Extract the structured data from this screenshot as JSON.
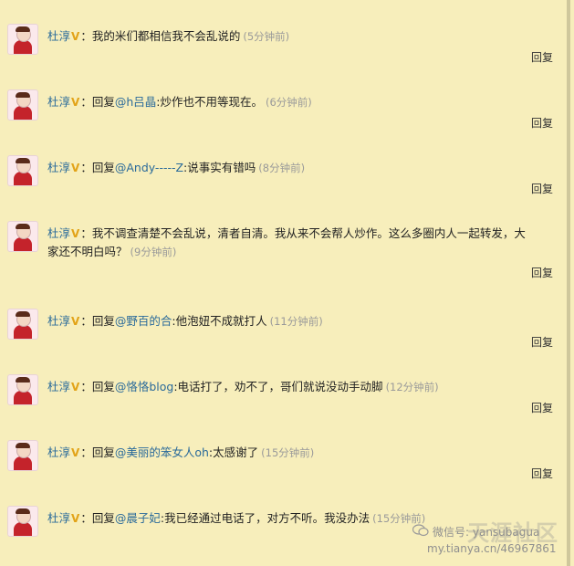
{
  "comments": [
    {
      "user": "杜淳",
      "badge": "V",
      "sep": "：",
      "prefix": "",
      "mention": "",
      "text": "我的米们都相信我不会乱说的",
      "time": "(5分钟前)",
      "reply": "回复"
    },
    {
      "user": "杜淳",
      "badge": "V",
      "sep": "：",
      "prefix": "回复",
      "mention": "@h吕晶",
      "text": ":炒作也不用等现在。",
      "time": "(6分钟前)",
      "reply": "回复"
    },
    {
      "user": "杜淳",
      "badge": "V",
      "sep": "：",
      "prefix": "回复",
      "mention": "@Andy-----Z",
      "text": ":说事实有错吗",
      "time": "(8分钟前)",
      "reply": "回复"
    },
    {
      "user": "杜淳",
      "badge": "V",
      "sep": "：",
      "prefix": "",
      "mention": "",
      "text": "我不调查清楚不会乱说，清者自清。我从来不会帮人炒作。这么多圈内人一起转发，大",
      "text2": "家还不明白吗？",
      "time": "(9分钟前)",
      "reply": "回复"
    },
    {
      "user": "杜淳",
      "badge": "V",
      "sep": "：",
      "prefix": "回复",
      "mention": "@野百的合",
      "text": ":他泡妞不成就打人",
      "time": "(11分钟前)",
      "reply": "回复"
    },
    {
      "user": "杜淳",
      "badge": "V",
      "sep": "：",
      "prefix": "回复",
      "mention": "@恪恪blog",
      "text": ":电话打了，劝不了，哥们就说没动手动脚",
      "time": "(12分钟前)",
      "reply": "回复"
    },
    {
      "user": "杜淳",
      "badge": "V",
      "sep": "：",
      "prefix": "回复",
      "mention": "@美丽的笨女人oh",
      "text": ":太感谢了",
      "time": "(15分钟前)",
      "reply": "回复"
    },
    {
      "user": "杜淳",
      "badge": "V",
      "sep": "：",
      "prefix": "回复",
      "mention": "@晨子妃",
      "text": ":我已经通过电话了，对方不听。我没办法",
      "time": "(15分钟前)",
      "reply": "回复"
    }
  ],
  "watermark": {
    "line1": "微信号: yansubagua",
    "line2": "my.tianya.cn/46967861",
    "brand": "天涯社区"
  }
}
